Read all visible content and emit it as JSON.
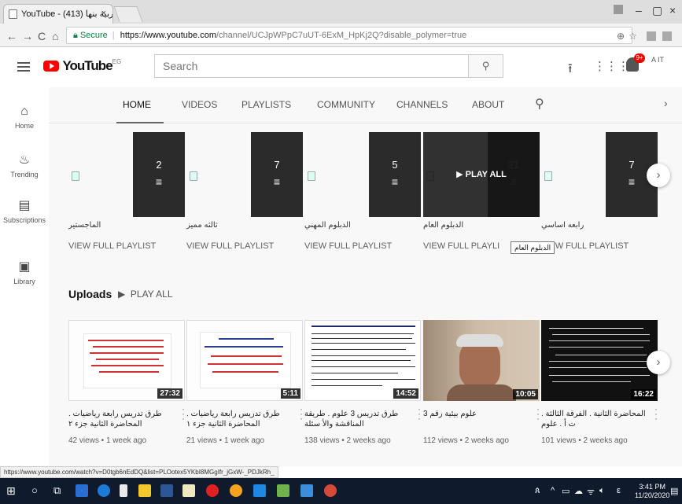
{
  "browser": {
    "tab_title": "YouTube - تربية بنها (413)",
    "tab_close": "×",
    "url_secure_label": "Secure",
    "url_host": "https://www.youtube.com",
    "url_path": "/channel/UCJpWPpC7uUT-6ExM_HpKj2Q?disable_polymer=true",
    "window_controls": [
      "–",
      "▢",
      "×"
    ]
  },
  "youtube": {
    "logo_text": "YouTube",
    "logo_country": "EG",
    "search_placeholder": "Search",
    "notification_count": "9+",
    "avatar_text": "A\nIT"
  },
  "guide": [
    {
      "icon": "home-icon",
      "label": "Home"
    },
    {
      "icon": "trending-icon",
      "label": "Trending"
    },
    {
      "icon": "subscriptions-icon",
      "label": "Subscriptions"
    },
    {
      "icon": "library-icon",
      "label": "Library"
    }
  ],
  "channel_tabs": [
    "HOME",
    "VIDEOS",
    "PLAYLISTS",
    "COMMUNITY",
    "CHANNELS",
    "ABOUT"
  ],
  "playlists": [
    {
      "count": "2",
      "title": "الماجستير",
      "action": "VIEW FULL PLAYLIST"
    },
    {
      "count": "7",
      "title": "ثالثه مميز",
      "action": "VIEW FULL PLAYLIST"
    },
    {
      "count": "5",
      "title": "الدبلوم المهني",
      "action": "VIEW FULL PLAYLIST"
    },
    {
      "count": "21",
      "title": "الدبلوم العام",
      "action": "VIEW FULL PLAYLI"
    },
    {
      "count": "7",
      "title": "رابعه اساسي",
      "action": "VIEW FULL PLAYLIST"
    }
  ],
  "play_all_overlay": "PLAY ALL",
  "tooltip": "الدبلوم العام",
  "uploads": {
    "heading": "Uploads",
    "play_all": "PLAY ALL",
    "videos": [
      {
        "duration": "27:32",
        "title": "طرق تدريس رابعة رياضيات . المحاضرة الثانية جزء ٢",
        "meta": "42 views • 1 week ago"
      },
      {
        "duration": "5:11",
        "title": "طرق تدريس رابعة رياضيات . المحاضرة الثانية جزء ١",
        "meta": "21 views • 1 week ago"
      },
      {
        "duration": "14:52",
        "title": "طرق تدريس 3 علوم . طريقة المناقشة والأ سئلة",
        "meta": "138 views • 2 weeks ago"
      },
      {
        "duration": "10:05",
        "title": "علوم بيئية رقم 3",
        "meta": "112 views • 2 weeks ago"
      },
      {
        "duration": "16:22",
        "title": "المحاضرة الثانية . الفرقة الثالثة . ت أ . علوم",
        "meta": "101 views • 2 weeks ago"
      }
    ]
  },
  "status_url": "https://www.youtube.com/watch?v=D0tgb6nEdDQ&list=PLOotex5YKbI8MGgIfr_jGxW-_PDJkRh_",
  "taskbar": {
    "time": "3:41 PM",
    "date": "11/20/2020",
    "lang": "ε"
  }
}
